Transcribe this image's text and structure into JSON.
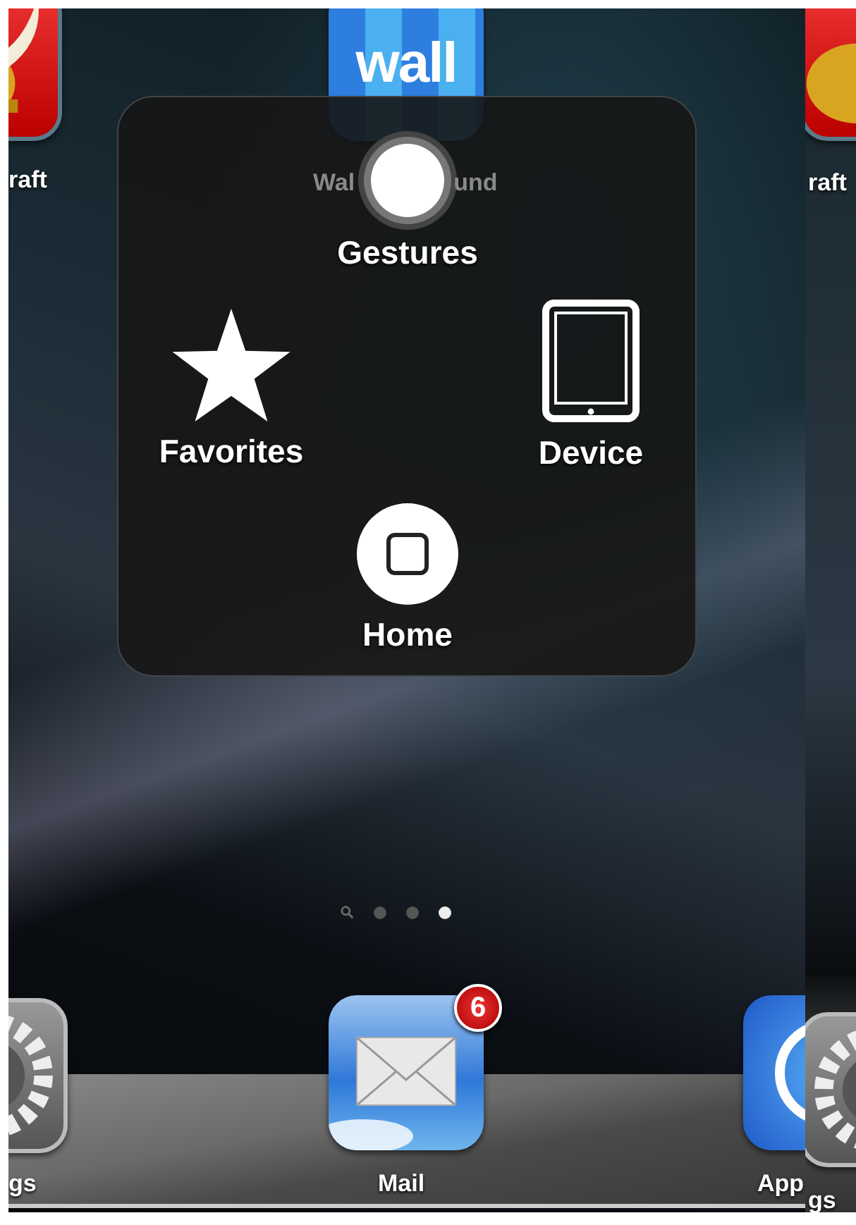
{
  "home_screen": {
    "top_row": [
      {
        "kind": "helmet",
        "label": "raft"
      },
      {
        "kind": "wall",
        "icon_text": "wall",
        "label_parts": [
          "Wal",
          "und"
        ]
      }
    ],
    "page_indicator": [
      {
        "kind": "search",
        "selected": false
      },
      {
        "kind": "dot",
        "selected": false
      },
      {
        "kind": "dot",
        "selected": false
      },
      {
        "kind": "dot",
        "selected": true
      }
    ],
    "dock": [
      {
        "kind": "gear",
        "label": "gs"
      },
      {
        "kind": "mail",
        "label": "Mail",
        "badge": "6"
      },
      {
        "kind": "appstore",
        "label": "App"
      }
    ]
  },
  "assistive_menu": {
    "items": [
      {
        "kind": "gestures",
        "label": "Gestures"
      },
      {
        "kind": "favorites",
        "label": "Favorites"
      },
      {
        "kind": "device",
        "label": "Device"
      },
      {
        "kind": "home",
        "label": "Home"
      }
    ]
  },
  "next_page_strip": {
    "top_label": "raft",
    "dock_label": "gs"
  }
}
